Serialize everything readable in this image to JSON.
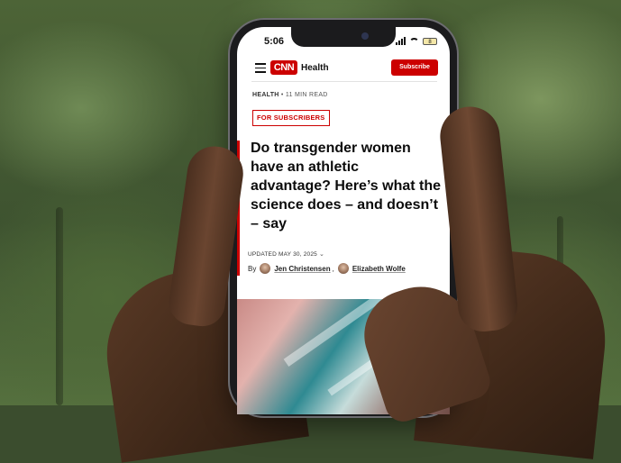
{
  "status_bar": {
    "time": "5:06",
    "battery": "8"
  },
  "header": {
    "logo": "CNN",
    "section": "Health",
    "subscribe_label": "Subscribe"
  },
  "article": {
    "category": "HEALTH",
    "read_time": "11 MIN READ",
    "badge": "FOR SUBSCRIBERS",
    "headline": "Do transgender women have an athletic advantage? Here’s what the science does – and doesn’t – say",
    "updated": "UPDATED MAY 30, 2025",
    "by_label": "By",
    "authors": [
      "Jen Christensen",
      "Elizabeth Wolfe"
    ],
    "author_separator": ","
  },
  "colors": {
    "brand_red": "#cc0000"
  },
  "icons": [
    "menu-icon",
    "signal-icon",
    "wifi-icon",
    "battery-icon",
    "chevron-down-icon"
  ]
}
